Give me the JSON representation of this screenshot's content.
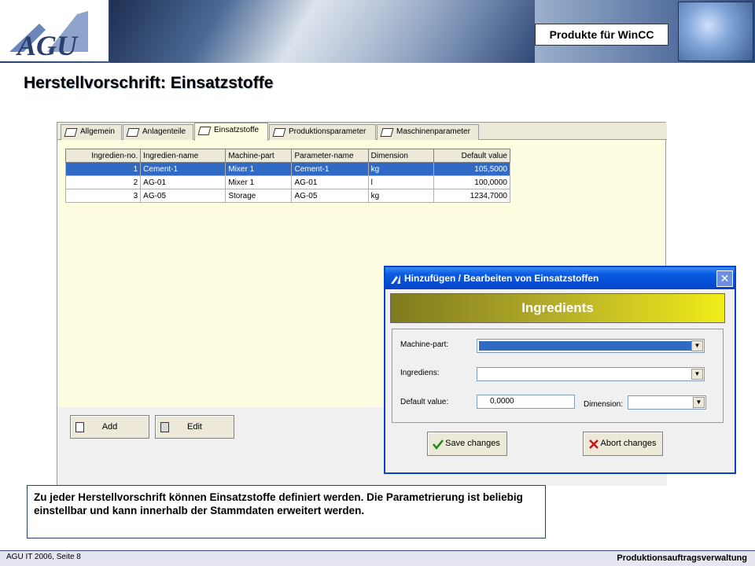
{
  "header": {
    "product_badge": "Produkte für WinCC",
    "page_title": "Herstellvorschrift: Einsatzstoffe"
  },
  "tabs": [
    {
      "label": "Allgemein"
    },
    {
      "label": "Anlagenteile"
    },
    {
      "label": "Einsatzstoffe"
    },
    {
      "label": "Produktionsparameter"
    },
    {
      "label": "Maschinenparameter"
    }
  ],
  "grid": {
    "columns": [
      "Ingredien-no.",
      "Ingredien-name",
      "Machine-part",
      "Parameter-name",
      "Dimension",
      "Default value"
    ],
    "rows": [
      [
        "1",
        "Cement-1",
        "Mixer 1",
        "Cement-1",
        "kg",
        "105,5000"
      ],
      [
        "2",
        "AG-01",
        "Mixer 1",
        "AG-01",
        "l",
        "100,0000"
      ],
      [
        "3",
        "AG-05",
        "Storage",
        "AG-05",
        "kg",
        "1234,7000"
      ]
    ]
  },
  "buttons": {
    "add": "Add",
    "edit": "Edit"
  },
  "dialog": {
    "title": "Hinzufügen / Bearbeiten von Einsatzstoffen",
    "banner": "Ingredients",
    "machine_part_label": "Machine-part:",
    "ingrediens_label": "Ingrediens:",
    "default_value_label": "Default value:",
    "default_value": "0,0000",
    "dimension_label": "Dimension:",
    "save": "Save changes",
    "abort": "Abort changes",
    "close_glyph": "✕"
  },
  "caption": "Zu jeder Herstellvorschrift können Einsatzstoffe definiert werden. Die Parametrierung ist beliebig einstellbar und kann innerhalb der Stammdaten erweitert werden.",
  "footer": {
    "left": "AGU IT 2006, Seite 8",
    "right": "Produktionsauftragsverwaltung"
  },
  "icons": {
    "dropdown_arrow": "▼"
  }
}
